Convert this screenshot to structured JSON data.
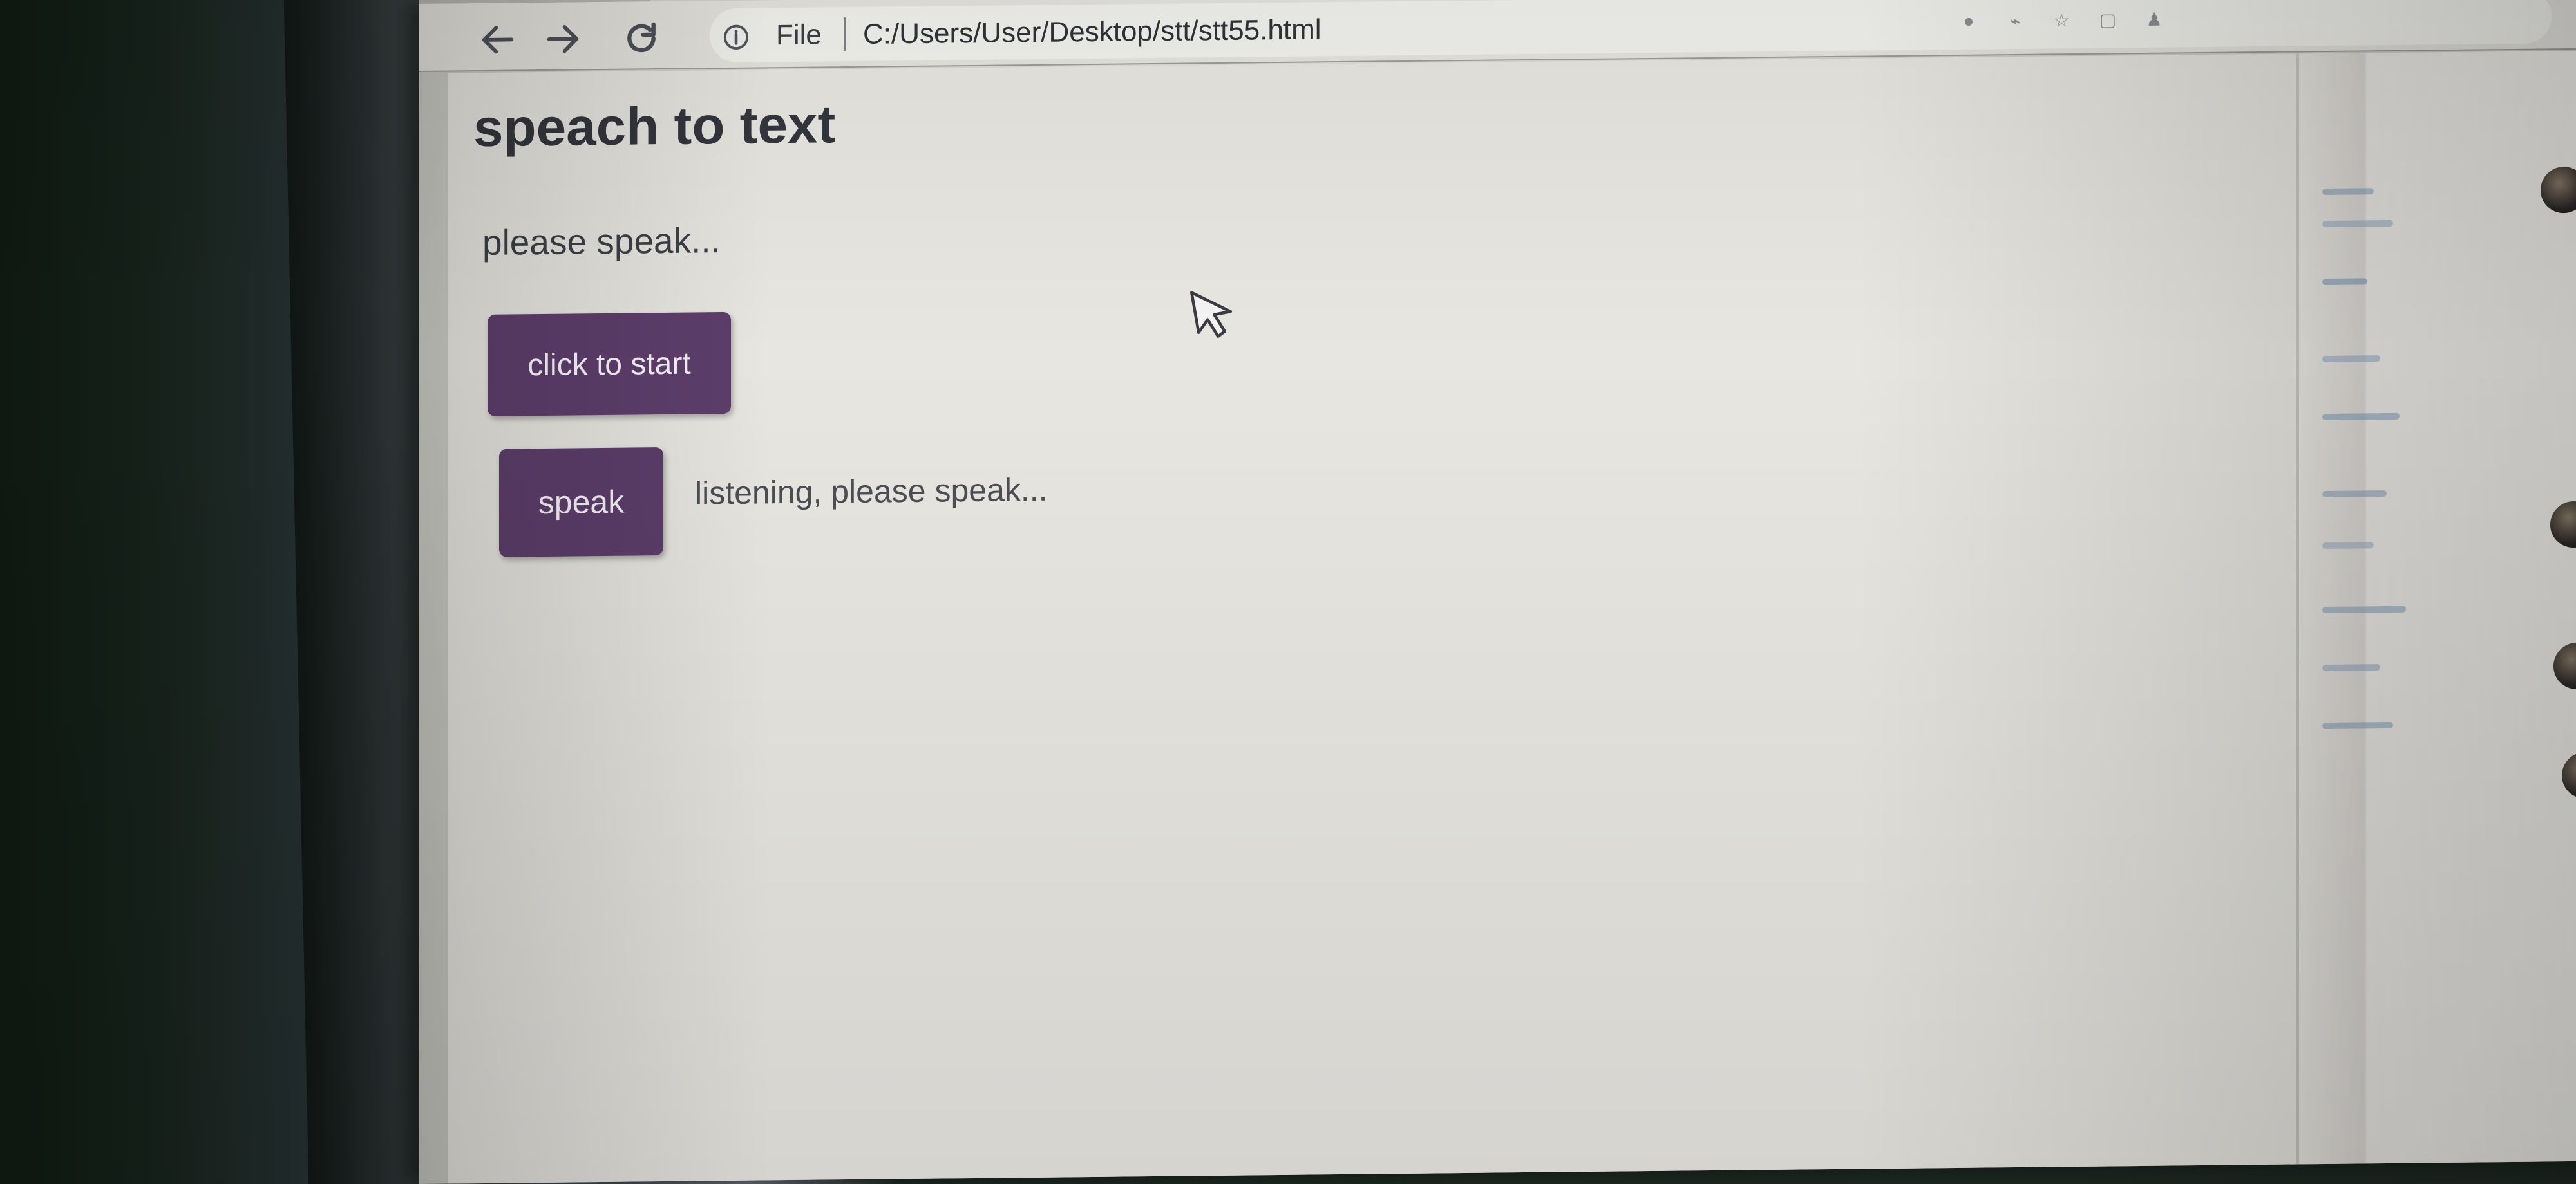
{
  "browser": {
    "url_prefix": "File",
    "url": "C:/Users/User/Desktop/stt/stt55.html",
    "icons": [
      "back-arrow-icon",
      "forward-arrow-icon",
      "reload-icon",
      "info-icon",
      "extension-icon",
      "star-icon",
      "tab-icon",
      "profile-icon"
    ]
  },
  "page": {
    "title": "speach to text",
    "status": "please speak...",
    "start_button": "click to start",
    "speak_button": "speak",
    "listening_status": "listening, please speak..."
  },
  "colors": {
    "button_purple": "#5d3e6b",
    "page_background": "#e7e6e1",
    "text_dark": "#34363d"
  }
}
